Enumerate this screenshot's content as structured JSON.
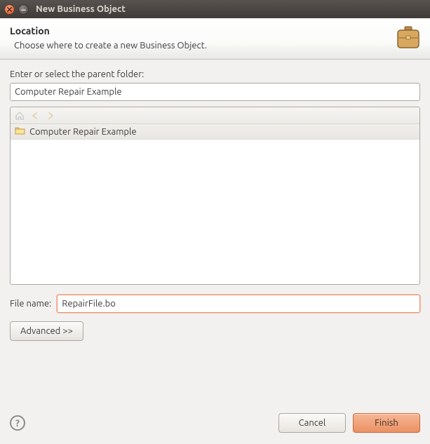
{
  "window": {
    "title": "New Business Object"
  },
  "header": {
    "title": "Location",
    "subtitle": "Choose where to create a new Business Object."
  },
  "parentFolder": {
    "label": "Enter or select the parent folder:",
    "value": "Computer Repair Example"
  },
  "tree": {
    "items": [
      {
        "label": "Computer Repair Example"
      }
    ]
  },
  "fileName": {
    "label": "File name:",
    "value": "RepairFile.bo"
  },
  "buttons": {
    "advanced": "Advanced >>",
    "cancel": "Cancel",
    "finish": "Finish"
  }
}
